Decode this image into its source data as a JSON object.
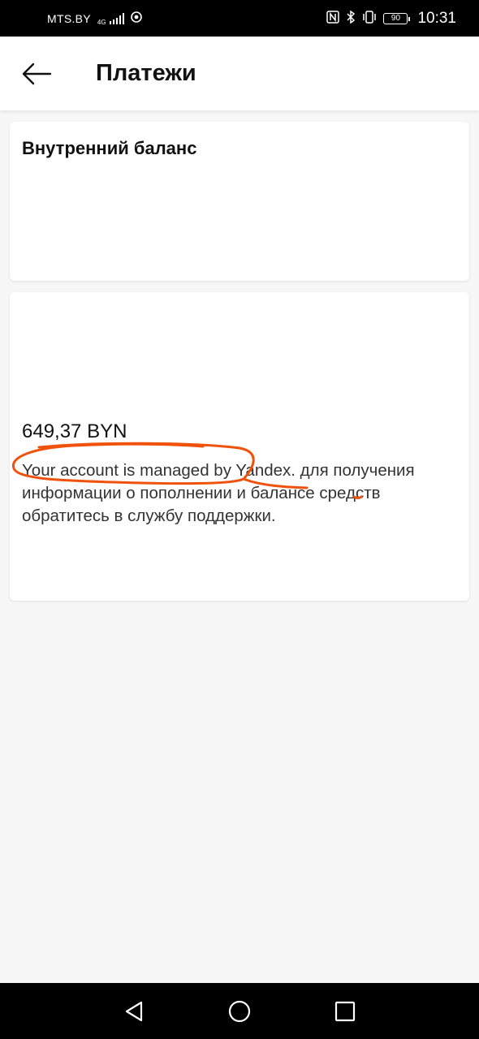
{
  "status_bar": {
    "carrier": "MTS.BY",
    "network": "4G",
    "battery": "90",
    "time": "10:31"
  },
  "header": {
    "title": "Платежи"
  },
  "internal_balance": {
    "title": "Внутренний баланс"
  },
  "balance": {
    "amount": "649,37 BYN",
    "info": "Your account is managed by Yandex.  для получения информации о пополнении и балансе средств обратитесь в службу поддержки."
  },
  "colors": {
    "annotation": "#f0520c",
    "background": "#f7f7f7",
    "card": "#ffffff"
  },
  "icons": {
    "back": "arrow-left-icon",
    "nav_back": "triangle-back-icon",
    "nav_home": "circle-home-icon",
    "nav_recents": "square-recents-icon"
  }
}
